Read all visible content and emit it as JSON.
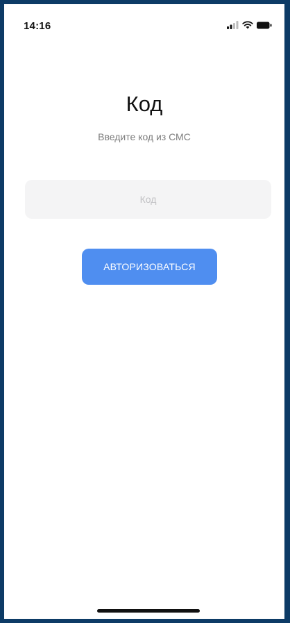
{
  "status_bar": {
    "time": "14:16",
    "icons": [
      "cellular-signal-icon",
      "wifi-icon",
      "battery-icon"
    ]
  },
  "screen": {
    "title": "Код",
    "subtitle": "Введите код из СМС"
  },
  "code_field": {
    "value": "",
    "placeholder": "Код"
  },
  "auth_button": {
    "label": "АВТОРИЗОВАТЬСЯ"
  },
  "colors": {
    "frame": "#0d3b66",
    "background": "#ffffff",
    "input_background": "#f4f4f5",
    "placeholder": "#c1c1c4",
    "subtitle": "#7c7c7c",
    "accent": "#4f8ef0"
  }
}
